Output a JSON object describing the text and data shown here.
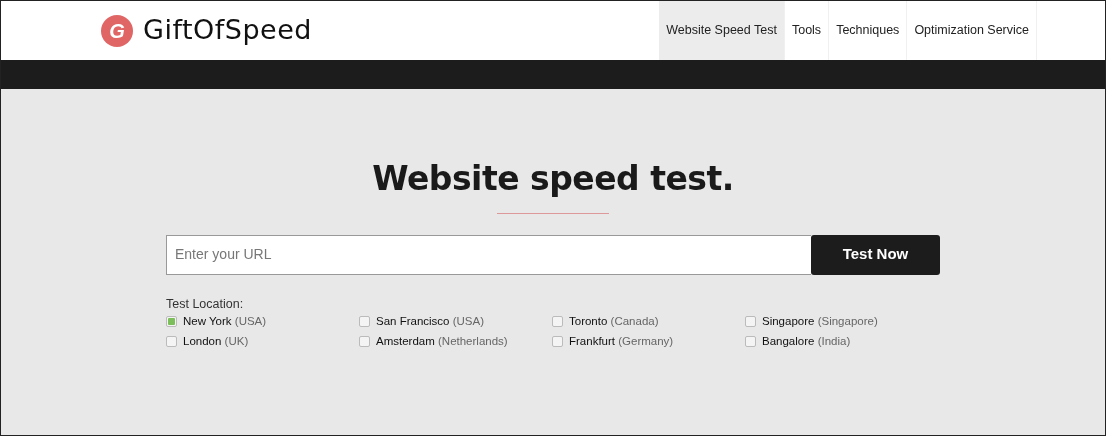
{
  "logo": {
    "mark": "G",
    "text": "GiftOfSpeed"
  },
  "nav": [
    {
      "label": "Website Speed Test",
      "selected": true
    },
    {
      "label": "Tools",
      "selected": false
    },
    {
      "label": "Techniques",
      "selected": false
    },
    {
      "label": "Optimization Service",
      "selected": false
    }
  ],
  "heading": "Website speed test.",
  "url_field": {
    "placeholder": "Enter your URL"
  },
  "submit_button": "Test Now",
  "location_label": "Test Location:",
  "locations": [
    {
      "city": "New York",
      "country": "(USA)",
      "checked": true
    },
    {
      "city": "San Francisco",
      "country": "(USA)",
      "checked": false
    },
    {
      "city": "Toronto",
      "country": "(Canada)",
      "checked": false
    },
    {
      "city": "Singapore",
      "country": "(Singapore)",
      "checked": false
    },
    {
      "city": "London",
      "country": "(UK)",
      "checked": false
    },
    {
      "city": "Amsterdam",
      "country": "(Netherlands)",
      "checked": false
    },
    {
      "city": "Frankfurt",
      "country": "(Germany)",
      "checked": false
    },
    {
      "city": "Bangalore",
      "country": "(India)",
      "checked": false
    }
  ]
}
